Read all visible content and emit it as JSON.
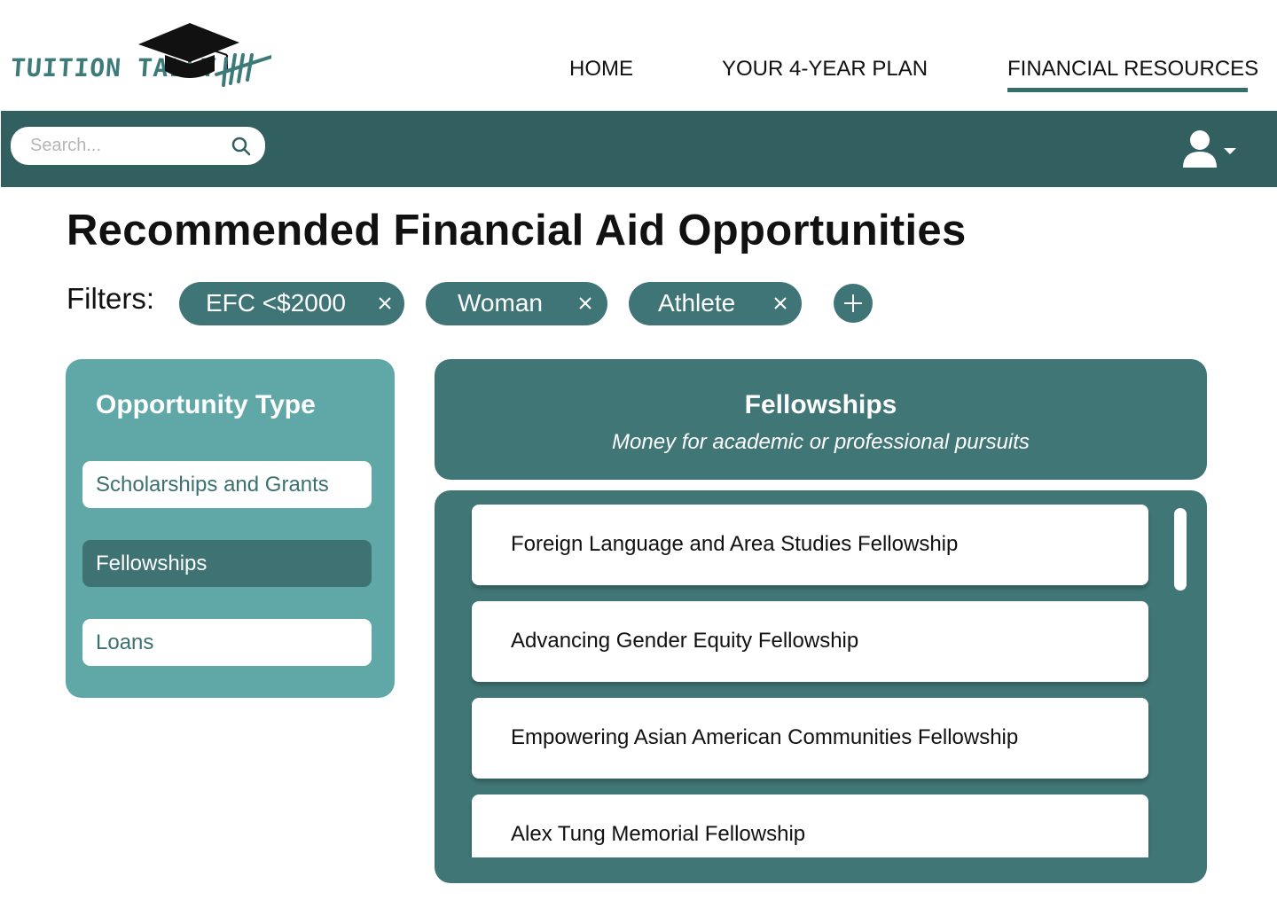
{
  "brand": {
    "logo_text": "TUITION TALLY"
  },
  "nav": {
    "items": [
      {
        "label": "HOME"
      },
      {
        "label": "YOUR 4-YEAR PLAN"
      },
      {
        "label": "FINANCIAL RESOURCES"
      }
    ],
    "active": "FINANCIAL RESOURCES"
  },
  "search": {
    "placeholder": "Search...",
    "value": ""
  },
  "page": {
    "title": "Recommended Financial Aid Opportunities"
  },
  "filters": {
    "label": "Filters:",
    "chips": [
      {
        "label": "EFC <$2000"
      },
      {
        "label": "Woman"
      },
      {
        "label": "Athlete"
      }
    ]
  },
  "sidebar": {
    "title": "Opportunity Type",
    "items": [
      {
        "label": "Scholarships and Grants",
        "active": false
      },
      {
        "label": "Fellowships",
        "active": true
      },
      {
        "label": "Loans",
        "active": false
      }
    ]
  },
  "category": {
    "title": "Fellowships",
    "subtitle": "Money for academic or professional pursuits"
  },
  "opportunities": [
    {
      "name": "Foreign Language and Area Studies Fellowship"
    },
    {
      "name": "Advancing Gender Equity Fellowship"
    },
    {
      "name": "Empowering Asian American Communities Fellowship"
    },
    {
      "name": "Alex Tung Memorial Fellowship"
    }
  ],
  "colors": {
    "brand_teal": "#3d7a7a",
    "toolbar": "#325f60",
    "sidebar": "#60a8a7",
    "active_item": "#3f7273",
    "panel": "#417676"
  },
  "icons": {
    "logo": "graduation-cap-tally-icon",
    "search": "search-icon",
    "user": "user-icon",
    "caret": "caret-down-icon",
    "chip_remove": "close-icon",
    "add": "plus-icon"
  }
}
